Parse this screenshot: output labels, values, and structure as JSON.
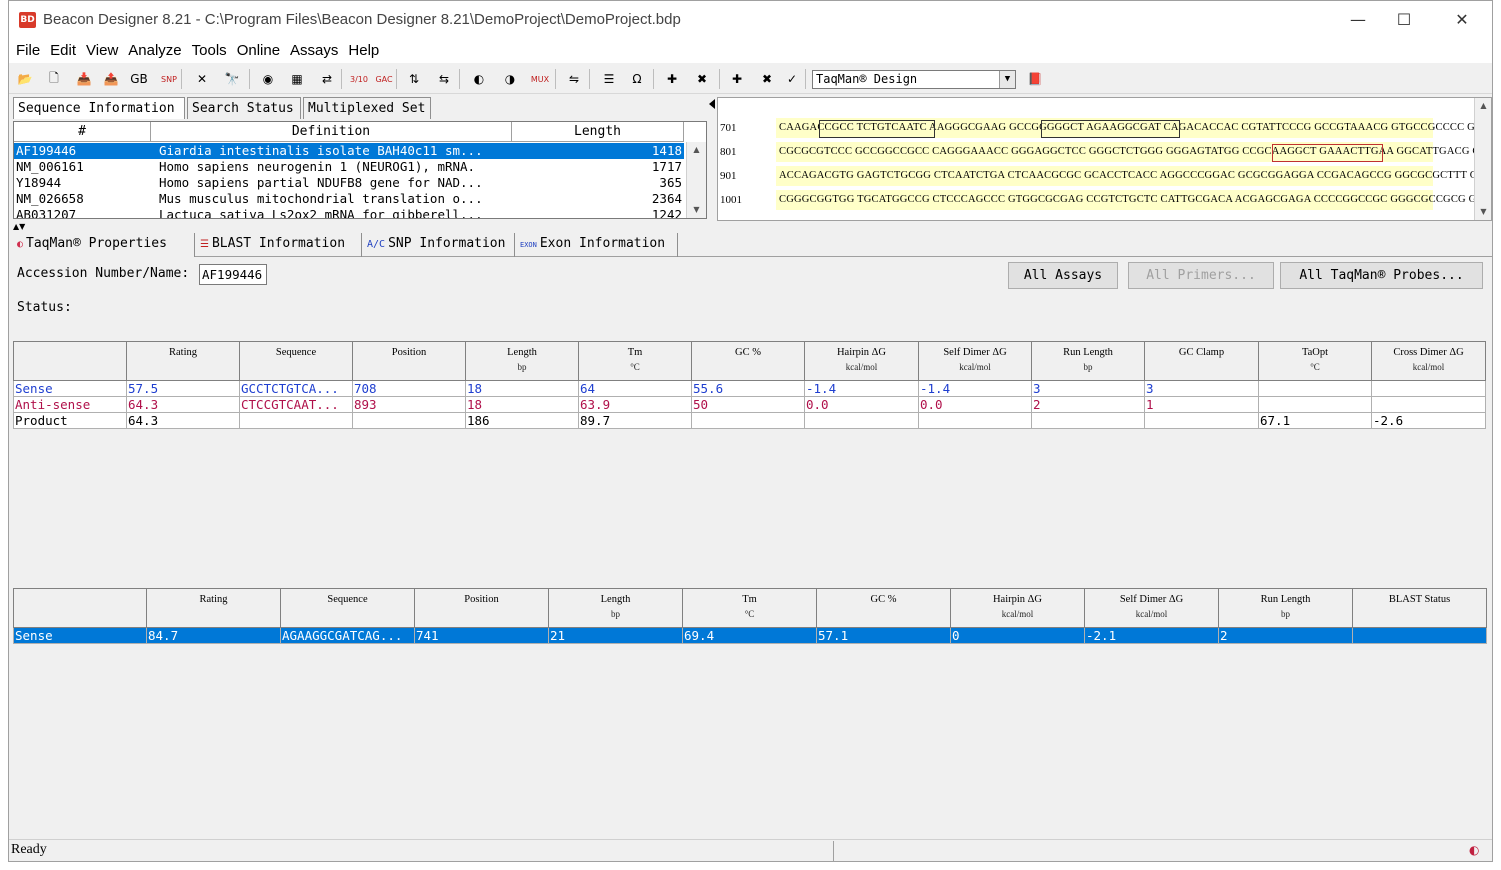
{
  "window": {
    "title": "Beacon Designer 8.21 - C:\\Program Files\\Beacon Designer 8.21\\DemoProject\\DemoProject.bdp",
    "icon_label": "BD"
  },
  "menu": [
    "File",
    "Edit",
    "View",
    "Analyze",
    "Tools",
    "Online",
    "Assays",
    "Help"
  ],
  "toolbar": {
    "mode_value": "TaqMan® Design",
    "icons": [
      {
        "name": "open-folder-icon",
        "glyph": "📂"
      },
      {
        "name": "new-document-icon",
        "glyph": "🗋"
      },
      {
        "name": "import-icon",
        "glyph": "📥"
      },
      {
        "name": "export-icon",
        "glyph": "📤"
      },
      {
        "name": "genbank-icon",
        "glyph": "GB"
      },
      {
        "name": "snp-icon",
        "glyph": "SNP"
      },
      {
        "name": "delete-icon",
        "glyph": "✕"
      },
      {
        "name": "find-icon",
        "glyph": "🔭"
      },
      {
        "name": "design-icon",
        "glyph": "◉"
      },
      {
        "name": "chart-icon",
        "glyph": "▦"
      },
      {
        "name": "translate-icon",
        "glyph": "⇄"
      },
      {
        "name": "ratio-icon",
        "glyph": "3/10"
      },
      {
        "name": "gac-icon",
        "glyph": "GAC"
      },
      {
        "name": "align-icon",
        "glyph": "⇅"
      },
      {
        "name": "swap-icon",
        "glyph": "⇆"
      },
      {
        "name": "probe-icon",
        "glyph": "◐"
      },
      {
        "name": "probe-add-icon",
        "glyph": "◑"
      },
      {
        "name": "multiplex-icon",
        "glyph": "MUX"
      },
      {
        "name": "compare-icon",
        "glyph": "⇋"
      },
      {
        "name": "list-icon",
        "glyph": "☰"
      },
      {
        "name": "omega-icon",
        "glyph": "Ω"
      },
      {
        "name": "exon-add-icon",
        "glyph": "✚"
      },
      {
        "name": "exon-remove-icon",
        "glyph": "✖"
      },
      {
        "name": "snp-add-icon",
        "glyph": "✚"
      },
      {
        "name": "snp-remove-icon",
        "glyph": "✖"
      },
      {
        "name": "snp-view-icon",
        "glyph": "✓"
      },
      {
        "name": "book-icon",
        "glyph": "📕"
      }
    ]
  },
  "top_tabs": [
    "Sequence Information",
    "Search Status",
    "Multiplexed Set"
  ],
  "sequence_list": {
    "columns": [
      "#",
      "Definition",
      "Length"
    ],
    "rows": [
      {
        "id": "AF199446",
        "definition": "Giardia intestinalis isolate BAH40c11 sm...",
        "length": "1418"
      },
      {
        "id": "NM_006161",
        "definition": "Homo sapiens neurogenin 1 (NEUROG1), mRNA.",
        "length": "1717"
      },
      {
        "id": "Y18944",
        "definition": "Homo sapiens partial NDUFB8 gene for NAD...",
        "length": "365"
      },
      {
        "id": "NM_026658",
        "definition": "Mus musculus mitochondrial translation o...",
        "length": "2364"
      },
      {
        "id": "AB031207",
        "definition": "Lactuca sativa Ls2ox2 mRNA for gibberell...",
        "length": "1242"
      }
    ]
  },
  "sequence_view": [
    {
      "pos": "701",
      "seq": "CAAGACCGCC TCTGTCAATC AAGGGCGAAG GCCGGGGGCT AGAAGGCGAT CAGACACCAC CGTATTCCCG GCCGTAAACG GTGCCGCCCC GCGGCCGGCG"
    },
    {
      "pos": "801",
      "seq": "CGCGCGTCCC GCCGGCCGCC CAGGGAAACC GGGAGGCTCC GGGCTCTGGG GGGAGTATGG CCGCAAGGCT GAAACTTGAA GGCATTGACG GAGGGTACC"
    },
    {
      "pos": "901",
      "seq": "ACCAGACGTG GAGTCTGCGG CTCAATCTGA CTCAACGCGC GCACCTCACC AGGCCCGGAC GCGCGGAGGA CCGACAGCCG GGCGCGCTTT CGCGATCGCG"
    },
    {
      "pos": "1001",
      "seq": "CGGGCGGTGG TGCATGGCCG CTCCCAGCCC GTGGCGCGAG CCGTCTGCTC CATTGCGACA ACGAGCGAGA CCCCGGCCGC GGGCGCCGCG GGACGGCCCG"
    }
  ],
  "mid_tabs": [
    {
      "label": "TaqMan® Properties",
      "icon": "◐"
    },
    {
      "label": "BLAST Information",
      "icon": "☰"
    },
    {
      "label": "SNP Information",
      "icon": "A/C"
    },
    {
      "label": "Exon Information",
      "icon": "EXON"
    }
  ],
  "properties": {
    "accession_label": "Accession Number/Name:",
    "accession_value": "AF199446",
    "status_label": "Status:",
    "buttons": {
      "all_assays": "All Assays",
      "all_primers": "All Primers...",
      "all_probes": "All TaqMan® Probes..."
    }
  },
  "primer_table": {
    "headers": [
      {
        "label": "",
        "unit": ""
      },
      {
        "label": "Rating",
        "unit": ""
      },
      {
        "label": "Sequence",
        "unit": ""
      },
      {
        "label": "Position",
        "unit": ""
      },
      {
        "label": "Length",
        "unit": "bp"
      },
      {
        "label": "Tm",
        "unit": "°C"
      },
      {
        "label": "GC %",
        "unit": ""
      },
      {
        "label": "Hairpin ΔG",
        "unit": "kcal/mol"
      },
      {
        "label": "Self Dimer ΔG",
        "unit": "kcal/mol"
      },
      {
        "label": "Run Length",
        "unit": "bp"
      },
      {
        "label": "GC Clamp",
        "unit": ""
      },
      {
        "label": "TaOpt",
        "unit": "°C"
      },
      {
        "label": "Cross Dimer ΔG",
        "unit": "kcal/mol"
      }
    ],
    "rows": [
      {
        "style": "sense",
        "cells": [
          "Sense",
          "57.5",
          "GCCTCTGTCA...",
          "708",
          "18",
          "64",
          "55.6",
          "-1.4",
          "-1.4",
          "3",
          "3",
          "",
          ""
        ]
      },
      {
        "style": "anti",
        "cells": [
          "Anti-sense",
          "64.3",
          "CTCCGTCAAT...",
          "893",
          "18",
          "63.9",
          "50",
          "0.0",
          "0.0",
          "2",
          "1",
          "",
          ""
        ]
      },
      {
        "style": "plain",
        "cells": [
          "Product",
          "64.3",
          "",
          "",
          "186",
          "89.7",
          "",
          "",
          "",
          "",
          "",
          "67.1",
          "-2.6"
        ]
      }
    ]
  },
  "probe_table": {
    "headers": [
      {
        "label": "",
        "unit": ""
      },
      {
        "label": "Rating",
        "unit": ""
      },
      {
        "label": "Sequence",
        "unit": ""
      },
      {
        "label": "Position",
        "unit": ""
      },
      {
        "label": "Length",
        "unit": "bp"
      },
      {
        "label": "Tm",
        "unit": "°C"
      },
      {
        "label": "GC %",
        "unit": ""
      },
      {
        "label": "Hairpin ΔG",
        "unit": "kcal/mol"
      },
      {
        "label": "Self Dimer ΔG",
        "unit": "kcal/mol"
      },
      {
        "label": "Run Length",
        "unit": "bp"
      },
      {
        "label": "BLAST Status",
        "unit": ""
      }
    ],
    "rows": [
      {
        "style": "selected",
        "cells": [
          "Sense",
          "84.7",
          "AGAAGGCGATCAG...",
          "741",
          "21",
          "69.4",
          "57.1",
          "0",
          "-2.1",
          "2",
          ""
        ]
      }
    ]
  },
  "status_bar": {
    "text": "Ready"
  }
}
